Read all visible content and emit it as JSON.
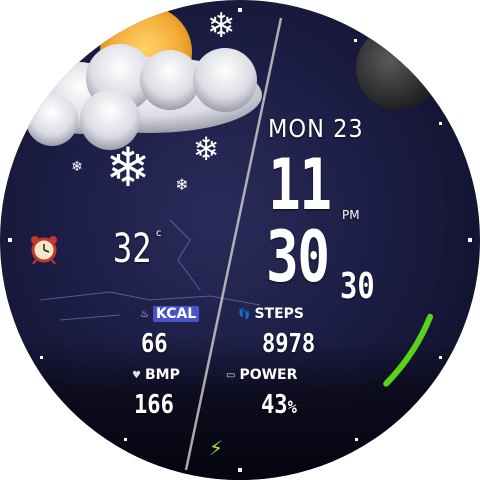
{
  "colors": {
    "background": "#1c1d44",
    "text": "#ffffff",
    "accent_green": "#5bd21a",
    "kcal_highlight": "#4a54c8",
    "divider": "#c8c8c8"
  },
  "weather": {
    "temperature": "32",
    "unit": "c",
    "icon": "cloudy-sunny-snow-icon"
  },
  "alarm": {
    "icon": "alarm-clock-icon"
  },
  "moon": {
    "icon": "moon-icon"
  },
  "date": {
    "text": "MON 23"
  },
  "time": {
    "hour": "11",
    "minute": "30",
    "ampm": "PM",
    "seconds": "30"
  },
  "stats": {
    "kcal": {
      "label": "KCAL",
      "value": "66",
      "icon": "flame-icon"
    },
    "steps": {
      "label": "STEPS",
      "value": "8978",
      "icon": "footprint-icon"
    },
    "bmp": {
      "label": "BMP",
      "value": "166",
      "icon": "heart-icon"
    },
    "power": {
      "label": "POWER",
      "value": "43",
      "unit": "%",
      "icon": "battery-icon"
    }
  },
  "charging": {
    "icon": "lightning-bolt-icon"
  },
  "progress_arc": {
    "fraction": 0.2,
    "icon": "battery-arc"
  }
}
